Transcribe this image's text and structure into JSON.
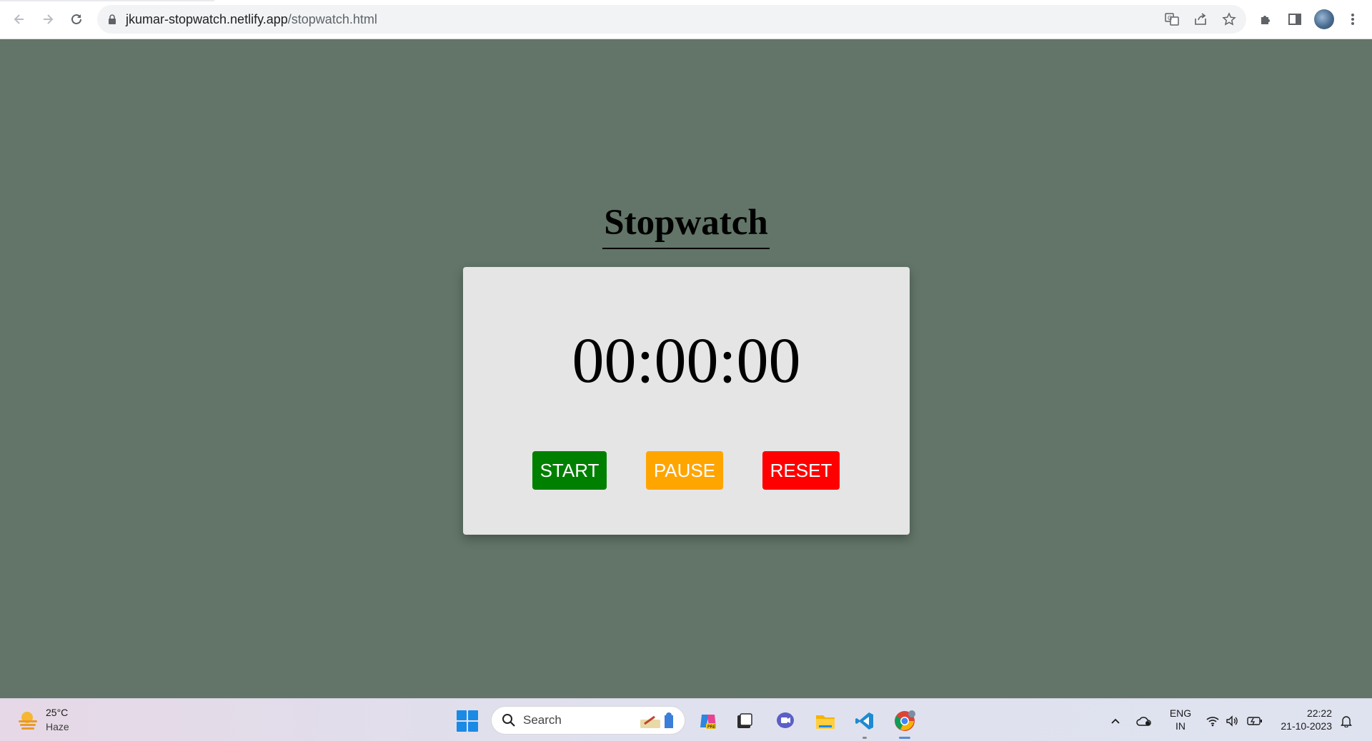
{
  "browser": {
    "url_host": "jkumar-stopwatch.netlify.app",
    "url_path": "/stopwatch.html",
    "icons": [
      "back-arrow-icon",
      "forward-arrow-icon",
      "reload-icon",
      "lock-icon",
      "translate-icon",
      "share-icon",
      "bookmark-star-icon",
      "extensions-icon",
      "side-panel-icon",
      "profile-avatar",
      "more-menu-icon"
    ]
  },
  "page": {
    "background": "#627568",
    "title": "Stopwatch",
    "time_display": "00:00:00",
    "buttons": {
      "start": {
        "label": "START",
        "color": "#008000"
      },
      "pause": {
        "label": "PAUSE",
        "color": "#ffa500"
      },
      "reset": {
        "label": "RESET",
        "color": "#ff0000"
      }
    }
  },
  "taskbar": {
    "weather": {
      "temp": "25°C",
      "condition": "Haze"
    },
    "search_label": "Search",
    "apps": [
      "windows-start-icon",
      "copilot-icon",
      "task-view-icon",
      "teams-chat-icon",
      "file-explorer-icon",
      "vscode-icon",
      "chrome-icon"
    ],
    "language": {
      "line1": "ENG",
      "line2": "IN"
    },
    "clock": {
      "time": "22:22",
      "date": "21-10-2023"
    }
  }
}
